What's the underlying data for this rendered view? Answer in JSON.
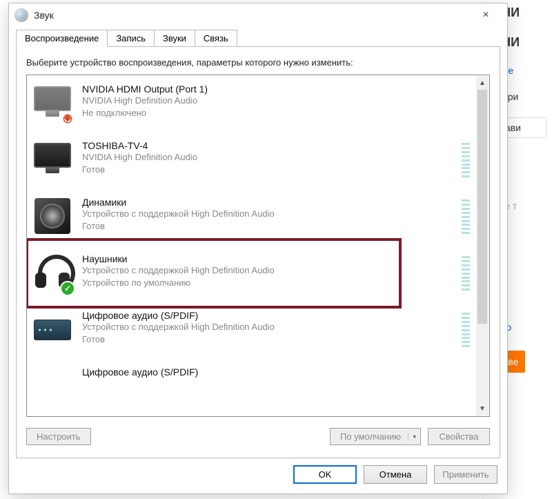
{
  "bg": {
    "line1": "ШНИ",
    "line2": "ШНИ",
    "tab": "ь Уче",
    "text1": "е вари",
    "like": "Нрави",
    "text2": "дите т",
    "photo": "Фото",
    "answer": "Отве"
  },
  "dialog": {
    "title": "Звук",
    "close_label": "×",
    "tabs": [
      "Воспроизведение",
      "Запись",
      "Звуки",
      "Связь"
    ],
    "active_tab": 0,
    "instruction": "Выберите устройство воспроизведения, параметры которого нужно изменить:",
    "devices": [
      {
        "name": "NVIDIA HDMI Output (Port 1)",
        "desc": "NVIDIA High Definition Audio",
        "status": "Не подключено",
        "meter": false,
        "badge": "red",
        "icon": "monitor-dim"
      },
      {
        "name": "TOSHIBA-TV-4",
        "desc": "NVIDIA High Definition Audio",
        "status": "Готов",
        "meter": true,
        "badge": "none",
        "icon": "monitor"
      },
      {
        "name": "Динамики",
        "desc": "Устройство с поддержкой High Definition Audio",
        "status": "Готов",
        "meter": true,
        "badge": "none",
        "icon": "speaker"
      },
      {
        "name": "Наушники",
        "desc": "Устройство с поддержкой High Definition Audio",
        "status": "Устройство по умолчанию",
        "meter": true,
        "badge": "green",
        "icon": "headphones"
      },
      {
        "name": "Цифровое аудио (S/PDIF)",
        "desc": "Устройство с поддержкой High Definition Audio",
        "status": "Готов",
        "meter": true,
        "badge": "none",
        "icon": "digital"
      },
      {
        "name": "Цифровое аудио (S/PDIF)",
        "desc": "",
        "status": "",
        "meter": false,
        "badge": "none",
        "icon": "digital"
      }
    ],
    "highlighted_index": 3,
    "buttons": {
      "configure": "Настроить",
      "set_default": "По умолчанию",
      "properties": "Свойства"
    },
    "dialog_buttons": {
      "ok": "OK",
      "cancel": "Отмена",
      "apply": "Применить"
    }
  },
  "colors": {
    "highlight": "#7a1a28",
    "default_border": "#0a6cd6"
  }
}
